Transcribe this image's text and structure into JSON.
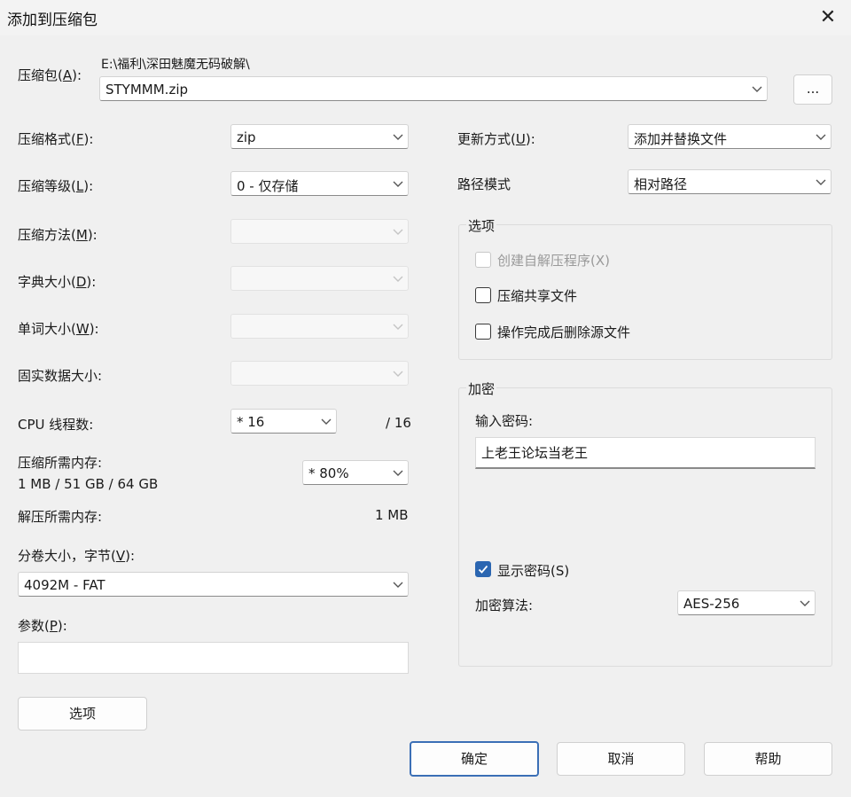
{
  "dialog": {
    "title": "添加到压缩包",
    "close_glyph": "✕"
  },
  "archive": {
    "label": "压缩包(",
    "label_key": "A",
    "label_end": "):",
    "path": "E:\\福利\\深田魅魔无码破解\\",
    "filename": "STYMMM.zip",
    "browse": "..."
  },
  "left": {
    "format": {
      "label": "压缩格式(",
      "key": "F",
      "end": "):",
      "value": "zip"
    },
    "level": {
      "label": "压缩等级(",
      "key": "L",
      "end": "):",
      "value": "0 - 仅存储"
    },
    "method": {
      "label": "压缩方法(",
      "key": "M",
      "end": "):",
      "value": ""
    },
    "dict": {
      "label": "字典大小(",
      "key": "D",
      "end": "):",
      "value": ""
    },
    "word": {
      "label": "单词大小(",
      "key": "W",
      "end": "):",
      "value": ""
    },
    "solid": {
      "label": "固实数据大小:",
      "value": ""
    },
    "threads": {
      "label": "CPU 线程数:",
      "value": "* 16",
      "max": "/ 16"
    },
    "mem_compress": {
      "label": "压缩所需内存:",
      "detail": "1 MB / 51 GB / 64 GB",
      "value": "* 80%"
    },
    "mem_decompress": {
      "label": "解压所需内存:",
      "value": "1 MB"
    },
    "volume": {
      "label": "分卷大小，字节(",
      "key": "V",
      "end": "):",
      "value": "4092M - FAT"
    },
    "params": {
      "label": "参数(",
      "key": "P",
      "end": "):",
      "value": ""
    },
    "options_btn": "选项"
  },
  "right": {
    "update": {
      "label": "更新方式(",
      "key": "U",
      "end": "):",
      "value": "添加并替换文件"
    },
    "path_mode": {
      "label": "路径模式",
      "value": "相对路径"
    },
    "options_group": {
      "title": "选项",
      "sfx": {
        "label": "创建自解压程序(X)",
        "checked": false,
        "enabled": false
      },
      "shared": {
        "label": "压缩共享文件",
        "checked": false
      },
      "delete_after": {
        "label": "操作完成后删除源文件",
        "checked": false
      }
    },
    "encrypt": {
      "title": "加密",
      "pw_label": "输入密码:",
      "password": "上老王论坛当老王",
      "show_pw": {
        "label": "显示密码(S)",
        "checked": true
      },
      "algo_label": "加密算法:",
      "algo": "AES-256"
    }
  },
  "buttons": {
    "ok": "确定",
    "cancel": "取消",
    "help": "帮助"
  },
  "colors": {
    "accent": "#2b66b1",
    "background": "#f0f0f0"
  }
}
